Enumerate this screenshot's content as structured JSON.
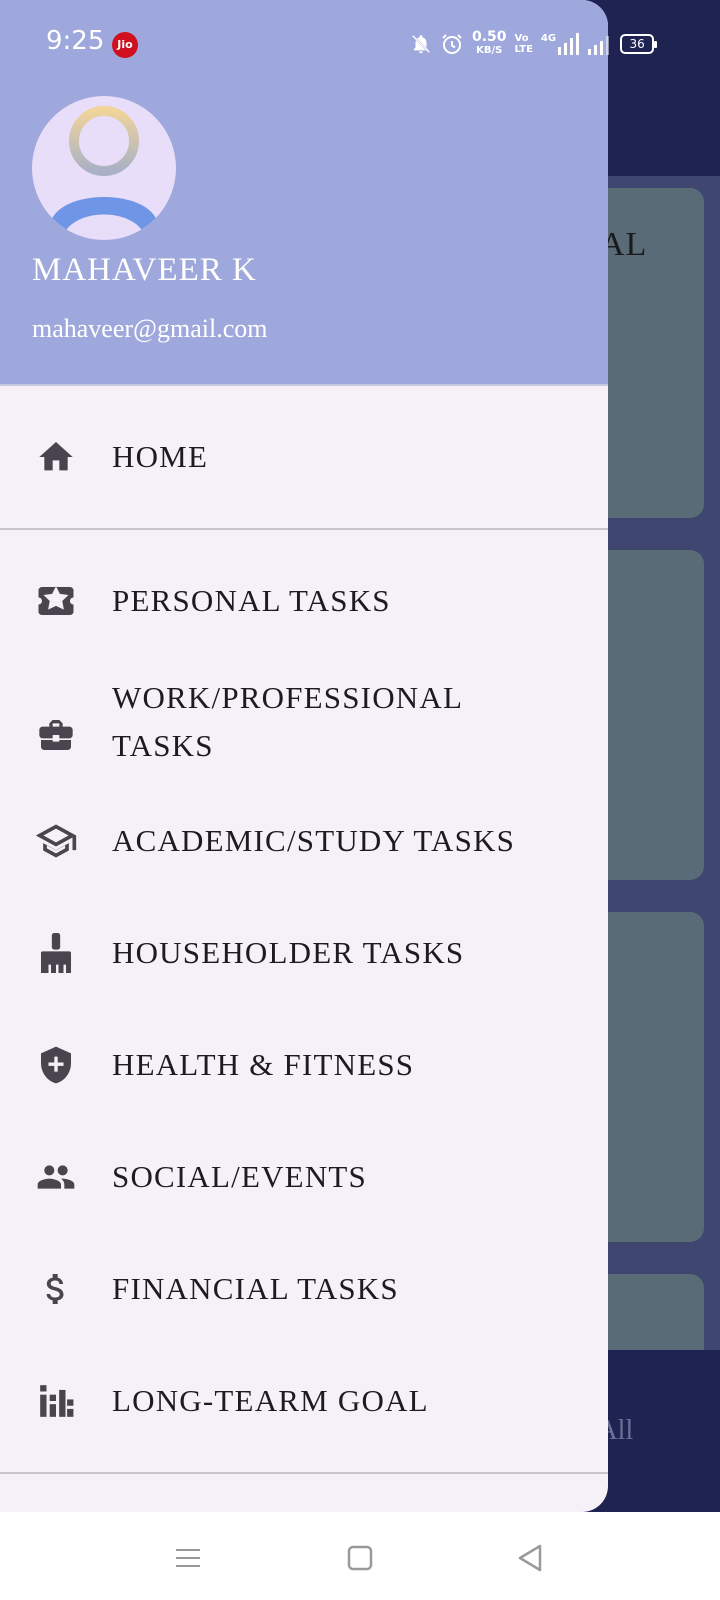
{
  "status_bar": {
    "time": "9:25",
    "carrier_badge": "Jio",
    "net_speed_value": "0.50",
    "net_speed_unit": "KB/S",
    "volte_top": "Vo",
    "volte_bottom": "LTE",
    "network_type": "4G",
    "battery": "36"
  },
  "background_app": {
    "card_text": "AL",
    "view_all_label": "y All"
  },
  "drawer": {
    "user_name": "MAHAVEER K",
    "user_email": "mahaveer@gmail.com",
    "items": [
      {
        "label": "HOME",
        "icon": "home-icon"
      },
      {
        "label": "PERSONAL TASKS",
        "icon": "star-ticket-icon"
      },
      {
        "label": "WORK/PROFESSIONAL TASKS",
        "line1": "WORK/PROFESSIONAL",
        "line2": "TASKS",
        "icon": "briefcase-icon"
      },
      {
        "label": "ACADEMIC/STUDY TASKS",
        "icon": "graduation-cap-icon"
      },
      {
        "label": "HOUSEHOLDER TASKS",
        "icon": "broom-icon"
      },
      {
        "label": "HEALTH & FITNESS",
        "icon": "medical-shield-icon"
      },
      {
        "label": "SOCIAL/EVENTS",
        "icon": "people-icon"
      },
      {
        "label": "FINANCIAL TASKS",
        "icon": "dollar-icon"
      },
      {
        "label": "LONG-TEARM GOAL",
        "icon": "bar-chart-icon"
      }
    ]
  },
  "colors": {
    "header_bg": "#9ea8dc",
    "drawer_bg": "#f6f1f8",
    "scrim_bg": "#1e2352",
    "icon": "#48454e"
  }
}
